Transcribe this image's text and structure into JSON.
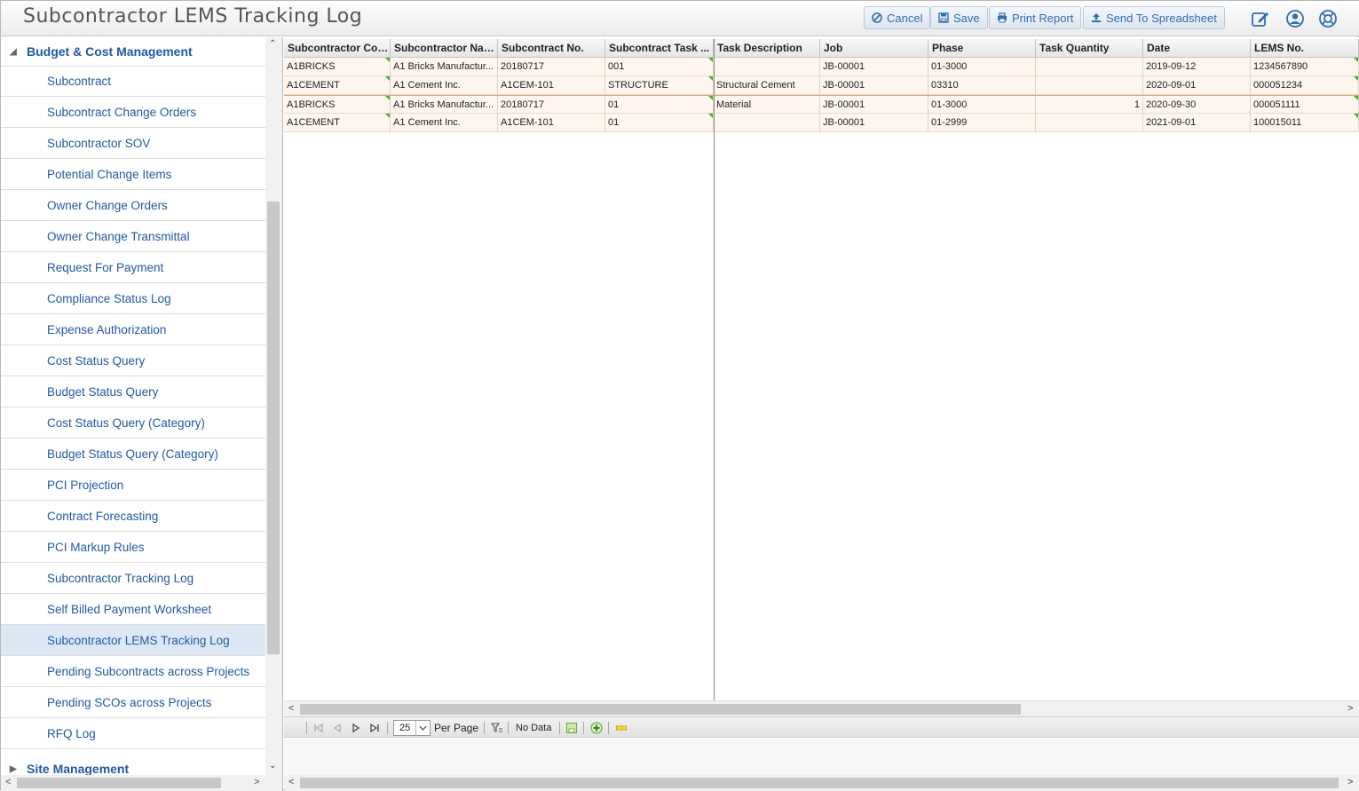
{
  "header": {
    "title": "Subcontractor LEMS Tracking Log",
    "buttons": {
      "cancel": "Cancel",
      "save": "Save",
      "print": "Print Report",
      "spreadsheet": "Send To Spreadsheet"
    },
    "icons": [
      "edit-icon",
      "user-icon",
      "help-icon"
    ]
  },
  "sidebar": {
    "group": "Budget & Cost Management",
    "items": [
      "Subcontract",
      "Subcontract Change Orders",
      "Subcontractor SOV",
      "Potential Change Items",
      "Owner Change Orders",
      "Owner Change Transmittal",
      "Request For Payment",
      "Compliance Status Log",
      "Expense Authorization",
      "Cost Status Query",
      "Budget Status Query",
      "Cost Status Query (Category)",
      "Budget Status Query (Category)",
      "PCI Projection",
      "Contract Forecasting",
      "PCI Markup Rules",
      "Subcontractor Tracking Log",
      "Self Billed Payment Worksheet",
      "Subcontractor LEMS Tracking Log",
      "Pending Subcontracts across Projects",
      "Pending SCOs across Projects",
      "RFQ Log"
    ],
    "selected_index": 18,
    "next_group": "Site Management"
  },
  "grid": {
    "columns": [
      "Subcontractor Code",
      "Subcontractor Name",
      "Subcontract No.",
      "Subcontract Task ...",
      "Task Description",
      "Job",
      "Phase",
      "Task Quantity",
      "Date",
      "LEMS No."
    ],
    "rows": [
      [
        "A1BRICKS",
        "A1 Bricks Manufactur...",
        "20180717",
        "001",
        "",
        "JB-00001",
        "01-3000",
        "",
        "2019-09-12",
        "1234567890"
      ],
      [
        "A1CEMENT",
        "A1 Cement Inc.",
        "A1CEM-101",
        "STRUCTURE",
        "Structural Cement",
        "JB-00001",
        "03310",
        "",
        "2020-09-01",
        "000051234"
      ],
      [
        "A1BRICKS",
        "A1 Bricks Manufactur...",
        "20180717",
        "01",
        "Material",
        "JB-00001",
        "01-3000",
        "1",
        "2020-09-30",
        "000051111"
      ],
      [
        "A1CEMENT",
        "A1 Cement Inc.",
        "A1CEM-101",
        "01",
        "",
        "JB-00001",
        "01-2999",
        "",
        "2021-09-01",
        "100015011"
      ]
    ]
  },
  "pager": {
    "page_size": "25",
    "per_page_label": "Per Page",
    "status": "No Data"
  },
  "colors": {
    "accent": "#1f5aa6",
    "row_bg": "#fdf5ee",
    "selected_nav": "#dde8f4",
    "flag": "#25c025"
  }
}
